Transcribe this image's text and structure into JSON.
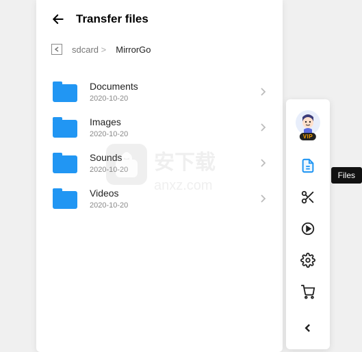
{
  "header": {
    "title": "Transfer files"
  },
  "breadcrumb": {
    "root": "sdcard",
    "separator": ">",
    "current": "MirrorGo"
  },
  "files": [
    {
      "name": "Documents",
      "date": "2020-10-20"
    },
    {
      "name": "Images",
      "date": "2020-10-20"
    },
    {
      "name": "Sounds",
      "date": "2020-10-20"
    },
    {
      "name": "Videos",
      "date": "2020-10-20"
    }
  ],
  "sidebar": {
    "vip_label": "VIP",
    "tooltip": "Files"
  },
  "watermark": {
    "text_cn": "安下载",
    "text_en": "anxz.com"
  }
}
